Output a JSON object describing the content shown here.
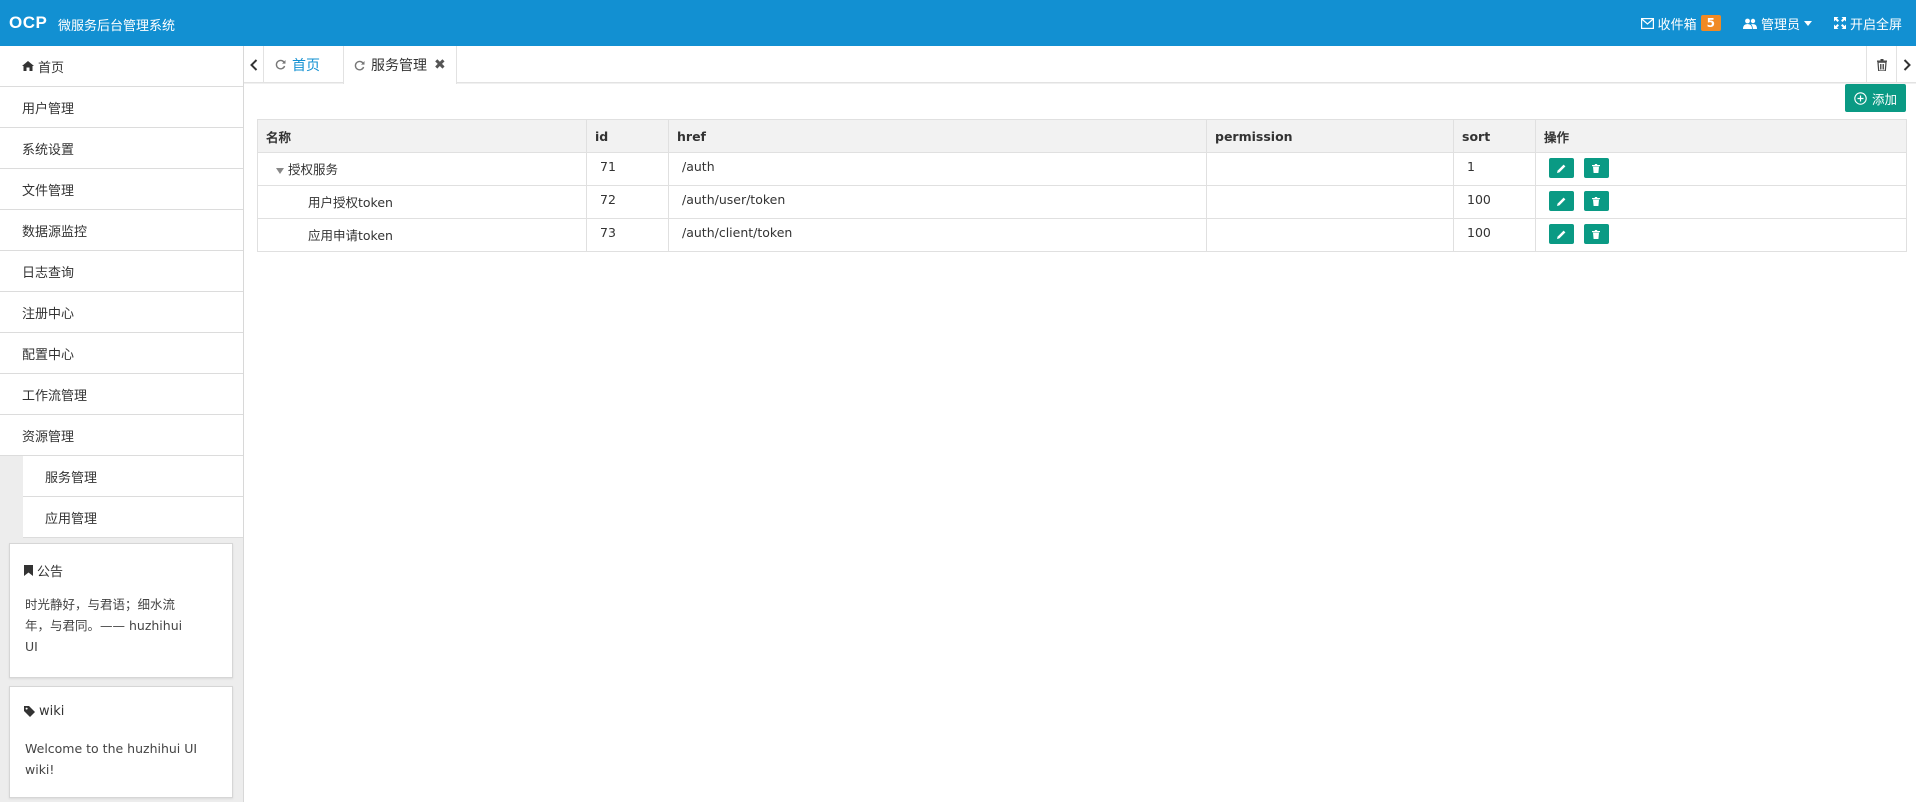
{
  "header": {
    "brand": "OCP",
    "subtitle": "微服务后台管理系统",
    "inbox_label": "收件箱",
    "inbox_count": "5",
    "user_label": "管理员",
    "fullscreen_label": "开启全屏"
  },
  "sidebar": {
    "items": [
      {
        "label": "首页"
      },
      {
        "label": "用户管理"
      },
      {
        "label": "系统设置"
      },
      {
        "label": "文件管理"
      },
      {
        "label": "数据源监控"
      },
      {
        "label": "日志查询"
      },
      {
        "label": "注册中心"
      },
      {
        "label": "配置中心"
      },
      {
        "label": "工作流管理"
      },
      {
        "label": "资源管理"
      }
    ],
    "subitems": [
      {
        "label": "服务管理"
      },
      {
        "label": "应用管理"
      }
    ],
    "notice": {
      "title": "公告",
      "body": "时光静好，与君语；细水流年，与君同。—— huzhihui UI"
    },
    "wiki": {
      "title": "wiki",
      "body": "Welcome to the huzhihui UI wiki!"
    }
  },
  "tabs": [
    {
      "label": "首页"
    },
    {
      "label": "服务管理"
    }
  ],
  "toolbar": {
    "add_label": "添加"
  },
  "table": {
    "headers": [
      "名称",
      "id",
      "href",
      "permission",
      "sort",
      "操作"
    ],
    "rows": [
      {
        "name": "授权服务",
        "id": "71",
        "href": "/auth",
        "permission": "",
        "sort": "1"
      },
      {
        "name": "用户授权token",
        "id": "72",
        "href": "/auth/user/token",
        "permission": "",
        "sort": "100"
      },
      {
        "name": "应用申请token",
        "id": "73",
        "href": "/auth/client/token",
        "permission": "",
        "sort": "100"
      }
    ]
  },
  "colors": {
    "header_bg": "#1290d2",
    "accent_green": "#0a9a84",
    "badge_orange": "#f08a24",
    "tab_active_text": "#1290d2"
  }
}
